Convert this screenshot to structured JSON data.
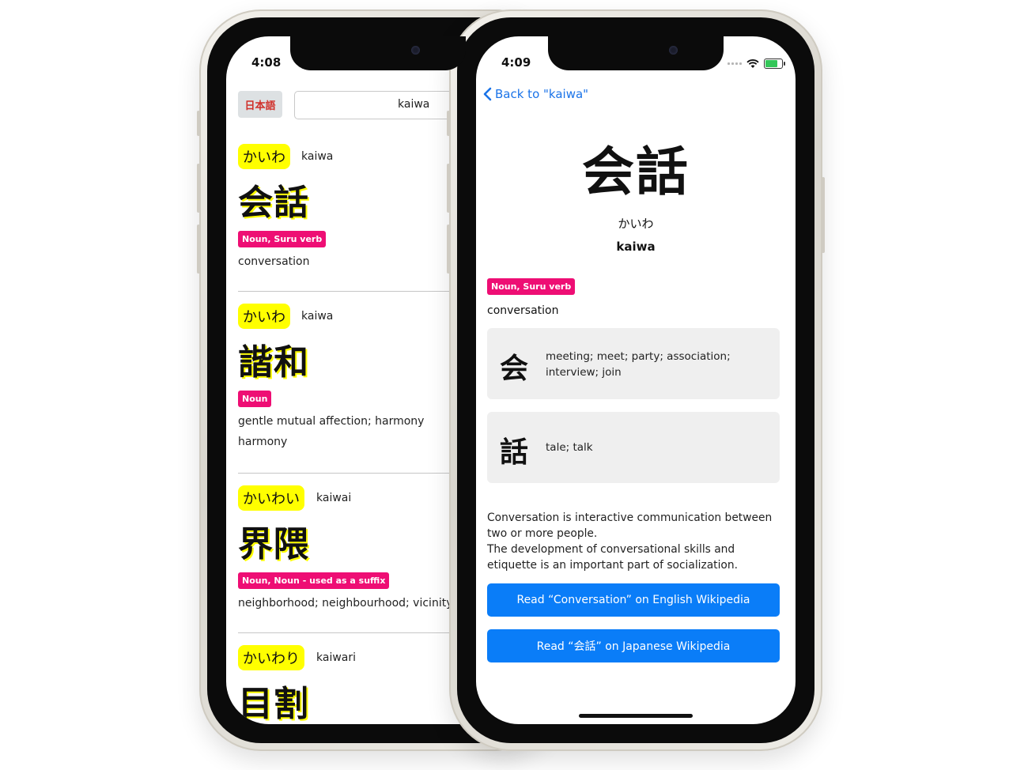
{
  "left_screen": {
    "time": "4:08",
    "lang_button": "日本語",
    "search_value": "kaiwa",
    "entries": [
      {
        "kana": "かいわ",
        "romaji": "kaiwa",
        "kanji": "会話",
        "pos": "Noun, Suru verb",
        "glosses": [
          "conversation"
        ]
      },
      {
        "kana": "かいわ",
        "romaji": "kaiwa",
        "kanji": "諧和",
        "pos": "Noun",
        "glosses": [
          "gentle mutual affection; harmony",
          "harmony"
        ]
      },
      {
        "kana": "かいわい",
        "romaji": "kaiwai",
        "kanji": "界隈",
        "pos": "Noun, Noun - used as a suffix",
        "glosses": [
          "neighborhood; neighbourhood; vicinity"
        ]
      },
      {
        "kana": "かいわり",
        "romaji": "kaiwari",
        "kanji": "目割"
      }
    ]
  },
  "right_screen": {
    "time": "4:09",
    "back_label": "Back to \"kaiwa\"",
    "kanji": "会話",
    "reading": "かいわ",
    "romaji": "kaiwa",
    "pos": "Noun, Suru verb",
    "gloss": "conversation",
    "kanji_cards": [
      {
        "kanji": "会",
        "meaning": "meeting; meet; party; association; interview; join"
      },
      {
        "kanji": "話",
        "meaning": "tale; talk"
      }
    ],
    "description": "Conversation is interactive communication between two or more people.\nThe development of conversational skills and etiquette is an important part of socialization.",
    "wiki_en_button": "Read “Conversation” on English Wikipedia",
    "wiki_ja_button": "Read “会話” on Japanese Wikipedia"
  },
  "colors": {
    "kana_highlight": "#ffff00",
    "pos_badge": "#ee0e74",
    "link_blue": "#1a73e8",
    "wiki_button": "#0a7df8"
  }
}
